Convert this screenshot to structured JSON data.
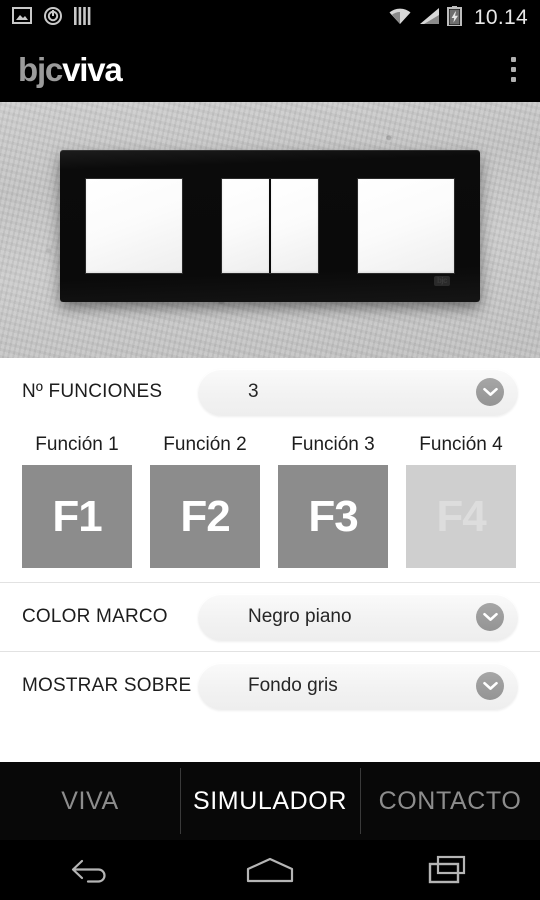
{
  "status_bar": {
    "time": "10.14",
    "left_icons": [
      "image-icon",
      "power-sync-icon",
      "equalizer-icon"
    ],
    "right_icons": [
      "wifi-icon",
      "cellular-signal-icon",
      "battery-charging-icon"
    ]
  },
  "app_bar": {
    "logo_part1": "bjc",
    "logo_part2": "viva",
    "overflow_label": "overflow-menu"
  },
  "preview": {
    "plate_brand": "bjc",
    "modules": [
      {
        "name": "module-1",
        "rockers": 1
      },
      {
        "name": "module-2",
        "rockers": 2
      },
      {
        "name": "module-3",
        "rockers": 1
      }
    ]
  },
  "controls": {
    "funciones": {
      "label": "Nº FUNCIONES",
      "value": "3"
    },
    "color_marco": {
      "label": "COLOR MARCO",
      "value": "Negro piano"
    },
    "mostrar_sobre": {
      "label": "MOSTRAR SOBRE",
      "value": "Fondo gris"
    }
  },
  "functions": [
    {
      "label": "Función 1",
      "tile": "F1",
      "enabled": true
    },
    {
      "label": "Función 2",
      "tile": "F2",
      "enabled": true
    },
    {
      "label": "Función 3",
      "tile": "F3",
      "enabled": true
    },
    {
      "label": "Función 4",
      "tile": "F4",
      "enabled": false
    }
  ],
  "tabs": [
    {
      "label": "VIVA",
      "active": false
    },
    {
      "label": "SIMULADOR",
      "active": true
    },
    {
      "label": "CONTACTO",
      "active": false
    }
  ],
  "nav_bar": {
    "back": "back-icon",
    "home": "home-icon",
    "recents": "recents-icon"
  },
  "colors": {
    "header_bg": "#000000",
    "tile_active": "#8c8c8c",
    "tile_disabled": "#cfcfcf",
    "accent_text": "#ffffff",
    "divider": "#e2e2e2"
  }
}
